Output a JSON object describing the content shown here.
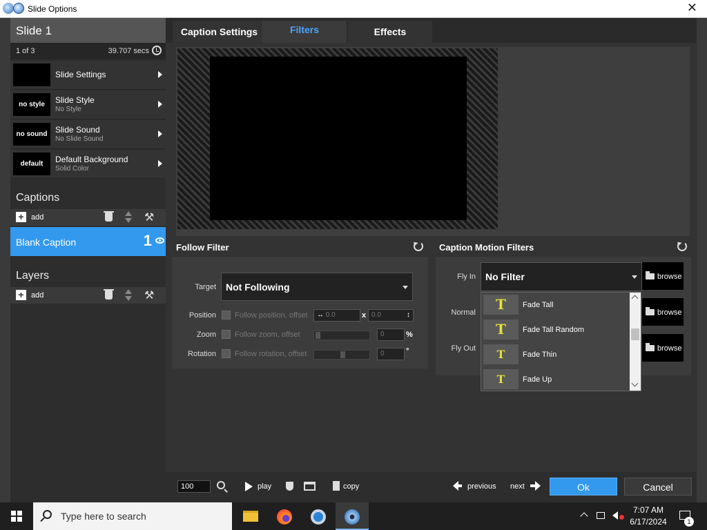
{
  "window": {
    "title": "Slide Options",
    "close_glyph": "✕"
  },
  "slide": {
    "title": "Slide 1",
    "position": "1 of 3",
    "duration": "39.707 secs",
    "options": [
      {
        "thumb": "",
        "title": "Slide Settings",
        "subtitle": ""
      },
      {
        "thumb": "no style",
        "title": "Slide Style",
        "subtitle": "No Style"
      },
      {
        "thumb": "no sound",
        "title": "Slide Sound",
        "subtitle": "No Slide Sound"
      },
      {
        "thumb": "default",
        "title": "Default Background",
        "subtitle": "Solid Color"
      }
    ]
  },
  "captions": {
    "heading": "Captions",
    "add_label": "add",
    "items": [
      {
        "label": "Blank Caption",
        "number": "1"
      }
    ]
  },
  "layers": {
    "heading": "Layers",
    "add_label": "add"
  },
  "tabs": [
    {
      "label": "Caption Settings",
      "active": false
    },
    {
      "label": "Filters",
      "active": true
    },
    {
      "label": "Effects",
      "active": false
    }
  ],
  "follow_filter": {
    "title": "Follow Filter",
    "target_label": "Target",
    "target_value": "Not Following",
    "position_label": "Position",
    "position_checkbox": "Follow position, offset",
    "position_x": "0.0",
    "position_sep": "x",
    "position_y": "0.0",
    "zoom_label": "Zoom",
    "zoom_checkbox": "Follow zoom, offset",
    "zoom_value": "0",
    "zoom_unit": "%",
    "rotation_label": "Rotation",
    "rotation_checkbox": "Follow rotation, offset",
    "rotation_value": "0",
    "rotation_unit": "°"
  },
  "motion_filters": {
    "title": "Caption Motion Filters",
    "fly_in_label": "Fly In",
    "fly_in_value": "No Filter",
    "normal_label": "Normal",
    "fly_out_label": "Fly Out",
    "browse_label": "browse",
    "list_items": [
      {
        "icon_text": "T",
        "name": "Fade Tall"
      },
      {
        "icon_text": "T",
        "name": "Fade Tall Random"
      },
      {
        "icon_text": "T",
        "name": "Fade Thin"
      },
      {
        "icon_text": "T",
        "name": "Fade Up"
      }
    ]
  },
  "bottom_bar": {
    "zoom_value": "100",
    "play_label": "play",
    "copy_label": "copy",
    "previous_label": "previous",
    "next_label": "next",
    "ok_label": "Ok",
    "cancel_label": "Cancel"
  },
  "taskbar": {
    "search_placeholder": "Type here to search",
    "time": "7:07 AM",
    "date": "6/17/2024",
    "notification_count": "1"
  },
  "colors": {
    "accent": "#3399ee",
    "active_tab_text": "#4aa3ff",
    "filter_icon": "#e3df3a"
  }
}
